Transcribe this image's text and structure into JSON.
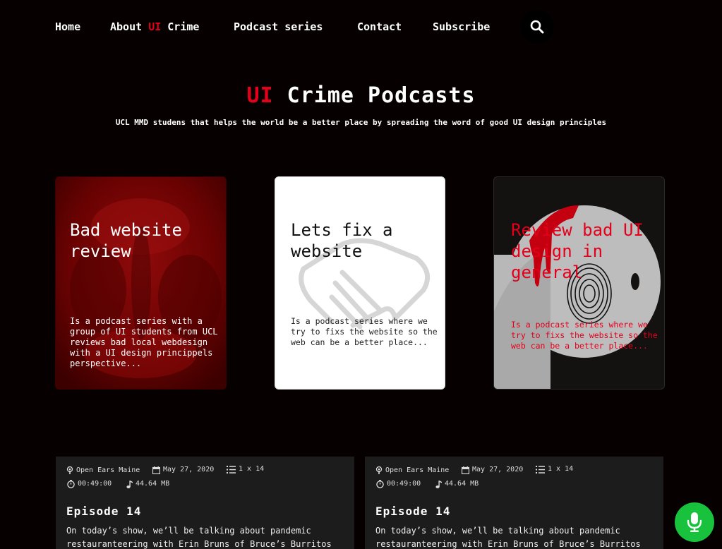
{
  "nav": {
    "home": "Home",
    "about_pre": "About ",
    "about_accent": "UI",
    "about_post": " Crime",
    "series": "Podcast series",
    "contact": "Contact",
    "subscribe": "Subscribe"
  },
  "hero": {
    "title_accent": "UI",
    "title_rest": " Crime Podcasts",
    "subtitle": "UCL MMD studens that helps the world be a better place by spreading the word of good UI design principles"
  },
  "series": [
    {
      "title": "Bad website review",
      "description": "Is a podcast series with a group of UI students from UCL reviews bad local webdesign with a UI design princippels perspective..."
    },
    {
      "title": "Lets fix a website",
      "description": "Is a podcast series where we try to fixs the website so the web can be a better place..."
    },
    {
      "title": "Review bad UI design in general",
      "description": "Is a podcast series where we try to fixs the website so the web can be a better place..."
    }
  ],
  "episodes": [
    {
      "show": "Open Ears Maine",
      "date": "May 27, 2020",
      "count": "1 x 14",
      "duration": "00:49:00",
      "size": "44.64 MB",
      "title": "Episode 14",
      "description": "On today’s show, we’ll be talking about pandemic restauranteering with Erin Bruns of Bruce’s Burritos"
    },
    {
      "show": "Open Ears Maine",
      "date": "May 27, 2020",
      "count": "1 x 14",
      "duration": "00:49:00",
      "size": "44.64 MB",
      "title": "Episode 14",
      "description": "On today’s show, we’ll be talking about pandemic restauranteering with Erin Bruns of Bruce’s Burritos"
    }
  ],
  "icons": {
    "search": "search-icon",
    "mic": "microphone-icon",
    "podcast": "podcast-icon",
    "calendar": "calendar-icon",
    "list": "list-icon",
    "timer": "stopwatch-icon",
    "music": "music-note-icon"
  },
  "colors": {
    "accent": "#e3001b",
    "background": "#060000",
    "mic_button": "#18c23d"
  }
}
